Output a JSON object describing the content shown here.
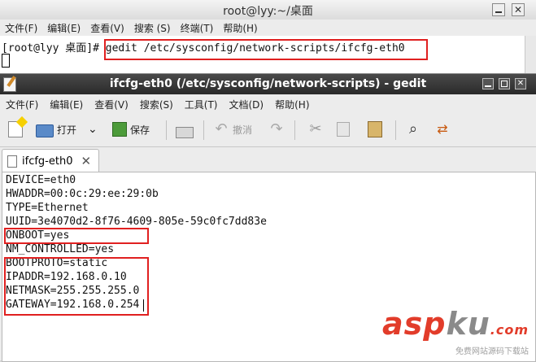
{
  "terminal": {
    "title": "root@lyy:~/桌面",
    "menu": [
      "文件(F)",
      "编辑(E)",
      "查看(V)",
      "搜索 (S)",
      "终端(T)",
      "帮助(H)"
    ],
    "prompt": "[root@lyy 桌面]#",
    "command": "gedit /etc/sysconfig/network-scripts/ifcfg-eth0"
  },
  "gedit": {
    "title": "ifcfg-eth0 (/etc/sysconfig/network-scripts) - gedit",
    "menu": [
      "文件(F)",
      "编辑(E)",
      "查看(V)",
      "搜索(S)",
      "工具(T)",
      "文档(D)",
      "帮助(H)"
    ],
    "toolbar": {
      "open_label": "打开",
      "save_label": "保存",
      "undo_label": "撤消"
    },
    "tab_label": "ifcfg-eth0",
    "lines": [
      "DEVICE=eth0",
      "HWADDR=00:0c:29:ee:29:0b",
      "TYPE=Ethernet",
      "UUID=3e4070d2-8f76-4609-805e-59c0fc7dd83e",
      "ONBOOT=yes",
      "NM_CONTROLLED=yes",
      "BOOTPROTO=static",
      "IPADDR=192.168.0.10",
      "NETMASK=255.255.255.0",
      "GATEWAY=192.168.0.254"
    ]
  },
  "watermark": {
    "brand_a": "asp",
    "brand_b": "ku",
    "brand_c": ".com",
    "sub": "免费网站源码下载站"
  },
  "colors": {
    "highlight": "#e02020",
    "titlebar_dark": "#2a2a2a"
  }
}
